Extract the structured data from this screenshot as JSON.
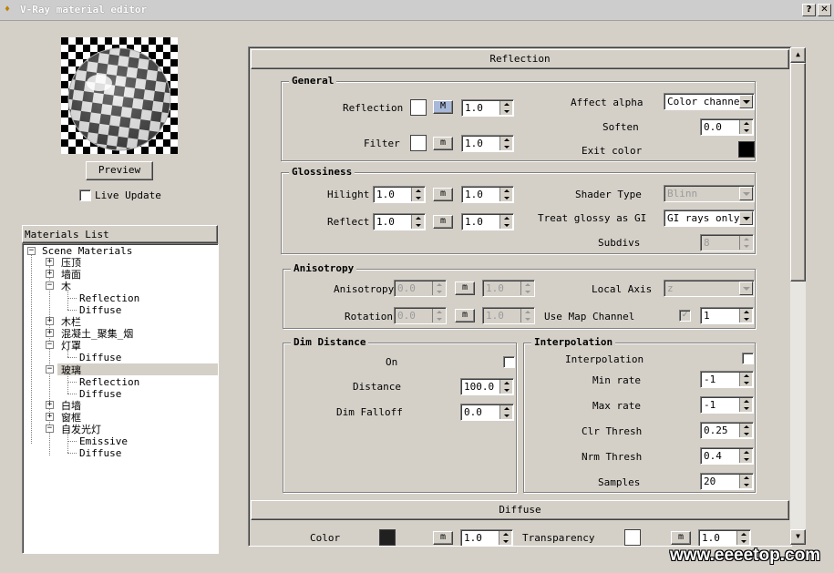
{
  "window": {
    "title": "V-Ray material editor",
    "help_label": "?",
    "close_label": "✕"
  },
  "preview": {
    "button_label": "Preview",
    "live_update_label": "Live Update"
  },
  "materials_list": {
    "title": "Materials List",
    "root": "Scene Materials",
    "items": [
      {
        "label": "压顶"
      },
      {
        "label": "墙面"
      },
      {
        "label": "木"
      },
      {
        "label": "Reflection"
      },
      {
        "label": "Diffuse"
      },
      {
        "label": "木栏"
      },
      {
        "label": "混凝土_聚集_烟"
      },
      {
        "label": "灯罩"
      },
      {
        "label": "Diffuse"
      },
      {
        "label": "玻璃"
      },
      {
        "label": "Reflection"
      },
      {
        "label": "Diffuse"
      },
      {
        "label": "白墙"
      },
      {
        "label": "窗框"
      },
      {
        "label": "自发光灯"
      },
      {
        "label": "Emissive"
      },
      {
        "label": "Diffuse"
      }
    ]
  },
  "reflection_rollout": {
    "title": "Reflection"
  },
  "general": {
    "title": "General",
    "reflection_label": "Reflection",
    "reflection_m": "M",
    "reflection_value": "1.0",
    "filter_label": "Filter",
    "filter_m": "m",
    "filter_value": "1.0",
    "affect_alpha_label": "Affect alpha",
    "affect_alpha_value": "Color channel",
    "soften_label": "Soften",
    "soften_value": "0.0",
    "exit_color_label": "Exit color"
  },
  "glossiness": {
    "title": "Glossiness",
    "hilight_label": "Hilight",
    "hilight_value": "1.0",
    "hilight_m": "m",
    "hilight_value2": "1.0",
    "reflect_label": "Reflect",
    "reflect_value": "1.0",
    "reflect_m": "m",
    "reflect_value2": "1.0",
    "shader_type_label": "Shader Type",
    "shader_type_value": "Blinn",
    "treat_glossy_label": "Treat glossy as GI",
    "treat_glossy_value": "GI rays only",
    "subdivs_label": "Subdivs",
    "subdivs_value": "8"
  },
  "anisotropy": {
    "title": "Anisotropy",
    "anisotropy_label": "Anisotropy",
    "anisotropy_value": "0.0",
    "anisotropy_m": "m",
    "anisotropy_value2": "1.0",
    "rotation_label": "Rotation",
    "rotation_value": "0.0",
    "rotation_m": "m",
    "rotation_value2": "1.0",
    "local_axis_label": "Local Axis",
    "local_axis_value": "z",
    "use_map_channel_label": "Use Map Channel",
    "use_map_channel_value": "1"
  },
  "dim_distance": {
    "title": "Dim Distance",
    "on_label": "On",
    "distance_label": "Distance",
    "distance_value": "100.0",
    "dim_falloff_label": "Dim Falloff",
    "dim_falloff_value": "0.0"
  },
  "interpolation": {
    "title": "Interpolation",
    "interpolation_label": "Interpolation",
    "min_rate_label": "Min rate",
    "min_rate_value": "-1",
    "max_rate_label": "Max rate",
    "max_rate_value": "-1",
    "clr_thresh_label": "Clr Thresh",
    "clr_thresh_value": "0.25",
    "nrm_thresh_label": "Nrm Thresh",
    "nrm_thresh_value": "0.4",
    "samples_label": "Samples",
    "samples_value": "20"
  },
  "diffuse_rollout": {
    "title": "Diffuse",
    "color_label": "Color",
    "color_m": "m",
    "color_value": "1.0",
    "transparency_label": "Transparency",
    "transparency_m": "m",
    "transparency_value": "1.0"
  },
  "watermark": "www.eeeetop.com"
}
